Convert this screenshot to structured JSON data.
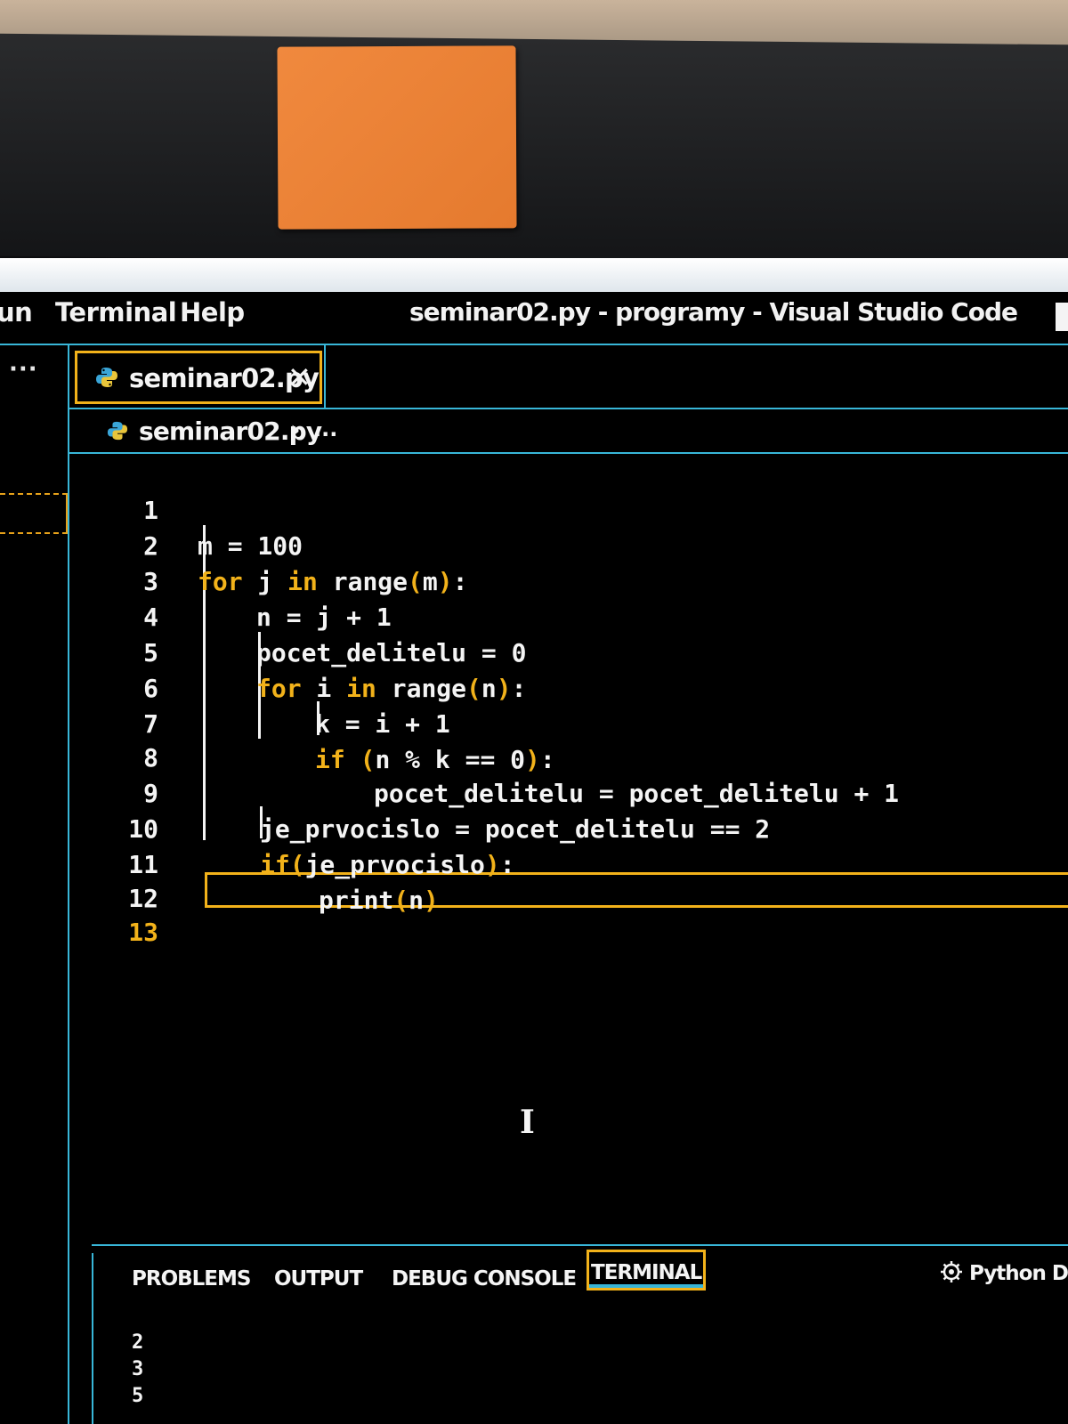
{
  "window": {
    "title": "seminar02.py - programy - Visual Studio Code"
  },
  "menu": {
    "items": [
      "un",
      "Terminal",
      "Help"
    ]
  },
  "activity": {
    "more_label": "···"
  },
  "tabs": [
    {
      "label": "seminar02.py",
      "close": "✕",
      "icon": "python-icon"
    }
  ],
  "breadcrumb": {
    "file": "seminar02.py",
    "separator": "›",
    "rest": "..."
  },
  "editor": {
    "active_line": 13,
    "lines": [
      {
        "num": "1"
      },
      {
        "num": "2"
      },
      {
        "num": "3"
      },
      {
        "num": "4"
      },
      {
        "num": "5"
      },
      {
        "num": "6"
      },
      {
        "num": "7"
      },
      {
        "num": "8"
      },
      {
        "num": "9"
      },
      {
        "num": "10"
      },
      {
        "num": "11"
      },
      {
        "num": "12"
      },
      {
        "num": "13"
      }
    ],
    "tokens": {
      "l1": {
        "a": "m = 100"
      },
      "l2": {
        "kw1": "for",
        "a": " j ",
        "kw2": "in",
        "fn": " range",
        "p1": "(",
        "b": "m",
        "p2": ")",
        "c": ":"
      },
      "l3": {
        "a": "n = j + 1"
      },
      "l4": {
        "a": "pocet_delitelu = 0"
      },
      "l5": {
        "kw1": "for",
        "a": " i ",
        "kw2": "in",
        "fn": " range",
        "p1": "(",
        "b": "n",
        "p2": ")",
        "c": ":"
      },
      "l6": {
        "a": "k = i + 1"
      },
      "l7": {
        "kw1": "if",
        "p1": " (",
        "a": "n % k == 0",
        "p2": ")",
        "c": ":"
      },
      "l8": {
        "a": "pocet_delitelu = pocet_delitelu + 1"
      },
      "l9": {
        "a": "je_prvocislo = pocet_delitelu == 2"
      },
      "l10": {
        "kw1": "if",
        "p1": "(",
        "a": "je_prvocislo",
        "p2": ")",
        "c": ":"
      },
      "l11": {
        "fn": "print",
        "p1": "(",
        "a": "n",
        "p2": ")"
      }
    }
  },
  "panel": {
    "tabs": [
      "PROBLEMS",
      "OUTPUT",
      "DEBUG CONSOLE",
      "TERMINAL"
    ],
    "active_tab": "TERMINAL",
    "right_label": "Python De",
    "right_icon": "debug-gear-icon",
    "terminal_lines": [
      "2",
      "3",
      "5"
    ]
  },
  "colors": {
    "accent_border": "#38b6d8",
    "focus_outline": "#f2b21a",
    "keyword": "#f2b21a",
    "background": "#000000",
    "foreground": "#f4f4f4"
  }
}
